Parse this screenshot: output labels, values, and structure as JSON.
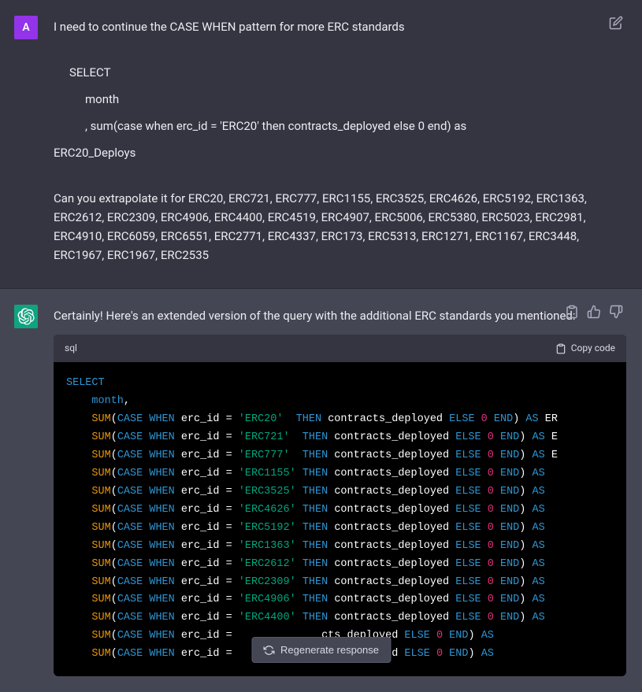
{
  "user": {
    "avatar_letter": "A",
    "line1": "I need to continue the CASE WHEN pattern for more ERC standards",
    "sql1": "SELECT",
    "sql2": "month",
    "sql3": ", sum(case when erc_id = 'ERC20' then contracts_deployed else 0 end) as",
    "sql4": "ERC20_Deploys",
    "line2": "Can you extrapolate it for ERC20, ERC721, ERC777, ERC1155, ERC3525, ERC4626, ERC5192, ERC1363, ERC2612, ERC2309, ERC4906, ERC4400, ERC4519, ERC4907, ERC5006, ERC5380, ERC5023, ERC2981, ERC4910, ERC6059, ERC6551, ERC2771, ERC4337, ERC173, ERC5313, ERC1271, ERC1167, ERC3448, ERC1967, ERC1967, ERC2535"
  },
  "assistant": {
    "intro": "Certainly! Here's an extended version of the query with the additional ERC standards you mentioned:",
    "code_lang": "sql",
    "copy_label": "Copy code",
    "select_kw": "SELECT",
    "month_kw": "month",
    "comma": ","
  },
  "code_rows": [
    {
      "erc": "'ERC20'",
      "tail_alias": "ER"
    },
    {
      "erc": "'ERC721'",
      "tail_alias": "E"
    },
    {
      "erc": "'ERC777'",
      "tail_alias": "E"
    },
    {
      "erc": "'ERC1155'"
    },
    {
      "erc": "'ERC3525'"
    },
    {
      "erc": "'ERC4626'"
    },
    {
      "erc": "'ERC5192'"
    },
    {
      "erc": "'ERC1363'"
    },
    {
      "erc": "'ERC2612'"
    },
    {
      "erc": "'ERC2309'"
    },
    {
      "erc": "'ERC4906'"
    },
    {
      "erc": "'ERC4400'"
    },
    {
      "erc": "''",
      "truncated": true
    },
    {
      "erc": "''",
      "truncated": true
    }
  ],
  "tokens": {
    "sum": "SUM",
    "open": "(",
    "close": ")",
    "case": "CASE",
    "when": "WHEN",
    "erc_id_eq": " erc_id ",
    "eq": "=",
    "then": "THEN",
    "col": " contracts_deployed ",
    "else": "ELSE",
    "zero": "0",
    "end": "END",
    "as": "AS",
    "cts": "cts_deployed "
  },
  "regen_label": "Regenerate response"
}
